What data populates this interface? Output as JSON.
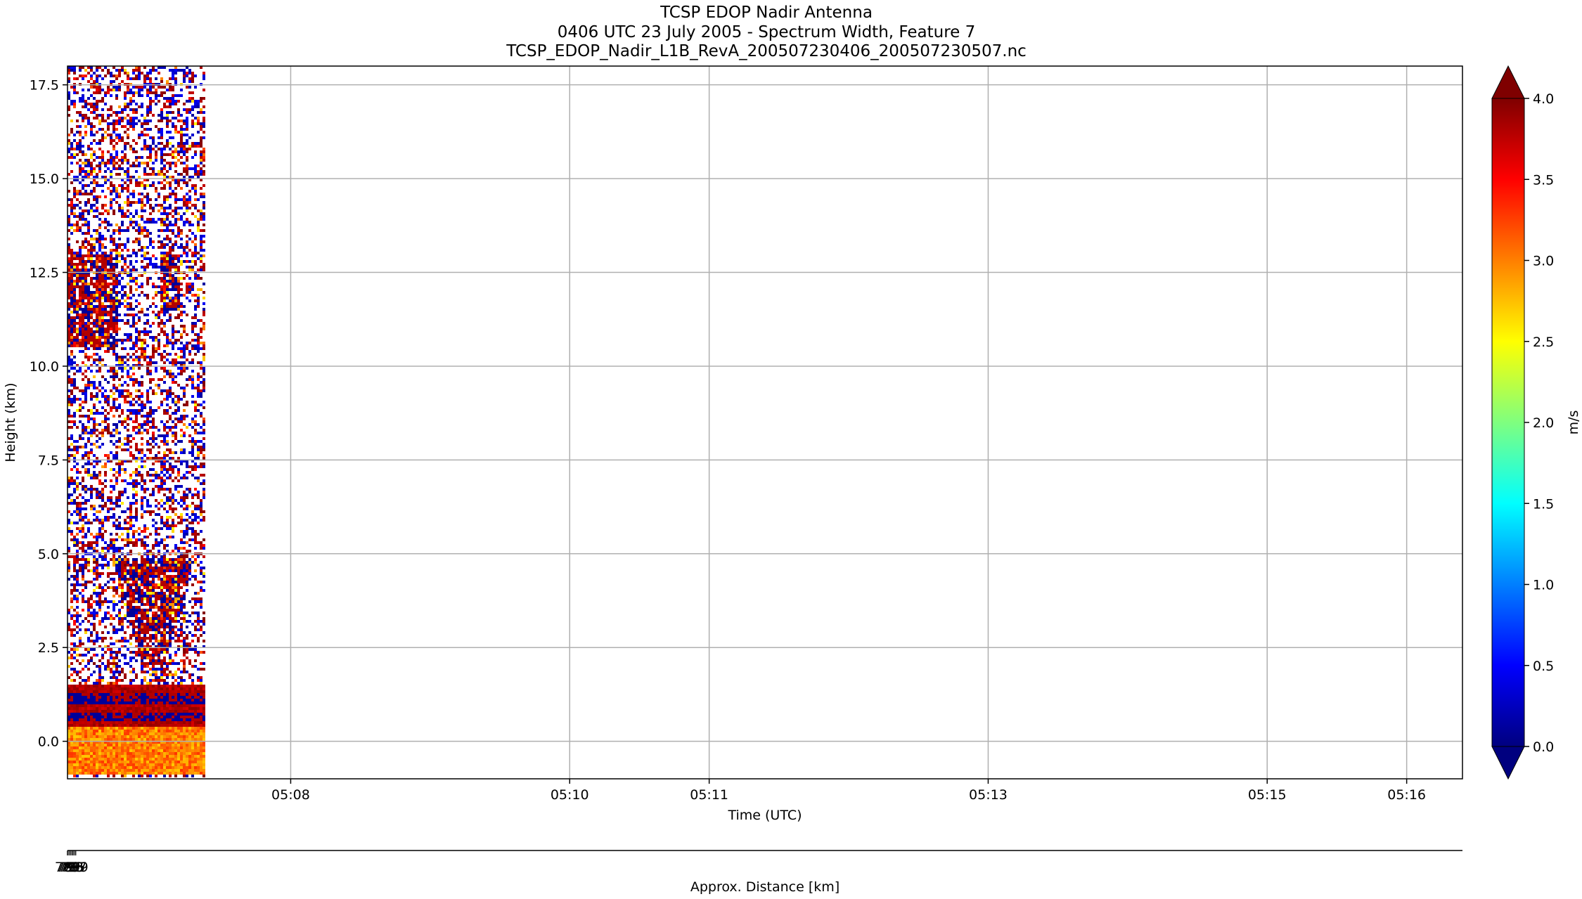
{
  "title_lines": [
    "TCSP EDOP Nadir Antenna",
    "0406 UTC 23 July 2005 - Spectrum Width, Feature 7",
    "TCSP_EDOP_Nadir_L1B_RevA_200507230406_200507230507.nc"
  ],
  "xlabel": "Time (UTC)",
  "ylabel": "Height (km)",
  "x2label": "Approx. Distance [km]",
  "colorbar_label": "m/s",
  "chart_data": {
    "type": "heatmap",
    "title": "TCSP EDOP Nadir Antenna\n0406 UTC 23 July 2005 - Spectrum Width, Feature 7\nTCSP_EDOP_Nadir_L1B_RevA_200507230406_200507230507.nc",
    "xlabel": "Time (UTC)",
    "ylabel": "Height (km)",
    "x2label": "Approx. Distance [km]",
    "grid": true,
    "xlim_minutes": [
      426.4,
      436.4
    ],
    "ylim": [
      -1.0,
      18.0
    ],
    "x_ticks": [
      {
        "v": 428,
        "label": "05:08"
      },
      {
        "v": 430,
        "label": "05:10"
      },
      {
        "v": 431,
        "label": "05:11"
      },
      {
        "v": 433,
        "label": "05:13"
      },
      {
        "v": 435,
        "label": "05:15"
      },
      {
        "v": 436,
        "label": "05:16"
      }
    ],
    "y_ticks": [
      0.0,
      2.5,
      5.0,
      7.5,
      10.0,
      12.5,
      15.0,
      17.5
    ],
    "y_tick_labels": [
      "0.0",
      "2.5",
      "5.0",
      "7.5",
      "10.0",
      "12.5",
      "15.0",
      "17.5"
    ],
    "distance_axis": {
      "range": [
        789,
        2500
      ],
      "ticks": [
        789,
        791,
        793,
        795,
        797,
        799
      ],
      "tick_labels": [
        "789",
        "791",
        "793",
        "795",
        "797",
        "799"
      ]
    },
    "data_extent": {
      "x_minutes": [
        426.4,
        427.4
      ],
      "y_km": [
        -1.0,
        18.0
      ]
    },
    "colorbar": {
      "label": "m/s",
      "vmin": 0.0,
      "vmax": 4.0,
      "ticks": [
        0.0,
        0.5,
        1.0,
        1.5,
        2.0,
        2.5,
        3.0,
        3.5,
        4.0
      ],
      "tick_labels": [
        "0.0",
        "0.5",
        "1.0",
        "1.5",
        "2.0",
        "2.5",
        "3.0",
        "3.5",
        "4.0"
      ],
      "extend": "both",
      "colormap_stops": [
        "#00007f",
        "#0000ff",
        "#007fff",
        "#00ffff",
        "#7fff7f",
        "#ffff00",
        "#ff7f00",
        "#ff0000",
        "#7f0000"
      ]
    },
    "features": [
      {
        "name": "surface-return",
        "y_range": [
          -0.9,
          0.4
        ],
        "value": 3.0
      },
      {
        "name": "near-surface-bands",
        "y_range": [
          0.5,
          1.5
        ],
        "value": 3.8
      },
      {
        "name": "rain-column",
        "y_range": [
          2.0,
          4.9
        ],
        "value": 3.6
      },
      {
        "name": "anvil-left",
        "y_range": [
          10.5,
          13.0
        ],
        "value": 3.2
      },
      {
        "name": "anvil-right",
        "y_range": [
          11.5,
          13.0
        ],
        "value": 3.4
      },
      {
        "name": "noise",
        "y_range": [
          1.5,
          18.0
        ],
        "value": "random"
      }
    ]
  }
}
